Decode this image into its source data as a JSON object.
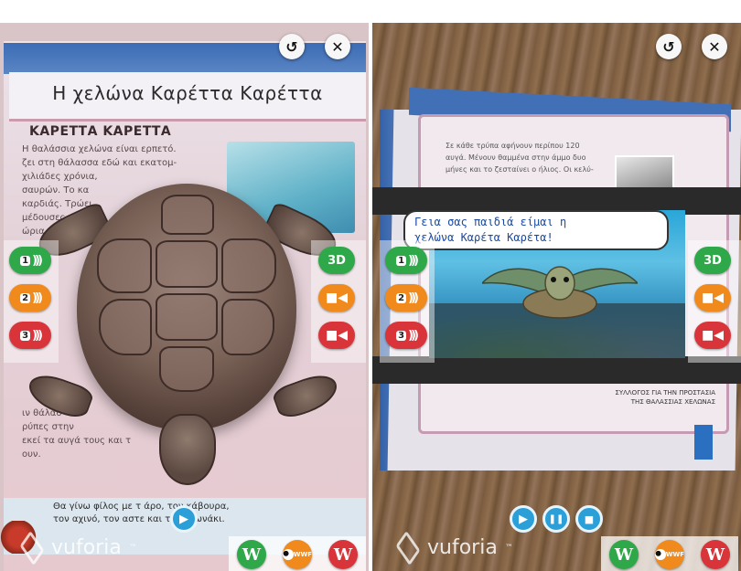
{
  "left_screen": {
    "book": {
      "page_title": "Η χελώνα Καρέττα Καρέττα",
      "section_heading": "ΚΑΡΕΤΤΑ ΚΑΡΕΤΤΑ",
      "body_lines": [
        "Η θαλάσσια χελώνα είναι ερπετό.",
        "ζει στη θάλασσα εδώ και εκατομ-",
        "χιλιάδες χρόνια,",
        "σαυρών. Το κα",
        "καρδιάς. Τρώει",
        "μέδουσες, αχιν",
        "ώρια"
      ],
      "lower_lines": [
        "ιν θάλασ",
        "ρύπες στην",
        "εκεί τα αυγά τους και τ",
        "ουν."
      ],
      "bottom_lines": [
        "Θα γίνω φίλος με τ         άρο, τον κάβουρα,",
        "τον αχινό, τον αστε          και το χελωνάκι."
      ]
    },
    "vuforia_label": "vuforia",
    "vuforia_tm": "™"
  },
  "right_screen": {
    "book": {
      "text_lines": [
        "Σε κάθε τρύπα αφήνουν περίπου 120",
        "αυγά. Μένουν θαμμένα στην άμμο δυο",
        "μήνες και το ζεσταίνει ο ήλιος. Οι κελύ-"
      ],
      "caption_lines": [
        "ΣΥΛΛΟΓΟΣ ΓΙΑ ΤΗΝ ΠΡΟΣΤΑΣΙΑ",
        "ΤΗΣ ΘΑΛΑΣΣΙΑΣ ΧΕΛΩΝΑΣ"
      ]
    },
    "speech_lines": [
      "Γεια σας παιδιά είμαι η",
      "χελώνα Καρέτα Καρέτα!"
    ],
    "vuforia_label": "vuforia",
    "vuforia_tm": "™"
  },
  "controls": {
    "reset_icon": "↺",
    "close_icon": "✕",
    "audio_buttons": [
      {
        "num": "1",
        "icon": "speaker-icon",
        "color": "#2fa84a"
      },
      {
        "num": "2",
        "icon": "speaker-icon",
        "color": "#f08a1c"
      },
      {
        "num": "3",
        "icon": "speaker-icon",
        "color": "#d9343a"
      }
    ],
    "btn_3d": "3D",
    "video_buttons": [
      {
        "label": "video 1",
        "color": "#f08a1c"
      },
      {
        "label": "video 2",
        "color": "#d9343a"
      }
    ],
    "play_icon": "▶",
    "pause_icon": "❚❚",
    "stop_icon": "■",
    "links": {
      "wiki_green": "W",
      "wwf": "WWF",
      "wiki_red": "W"
    }
  }
}
